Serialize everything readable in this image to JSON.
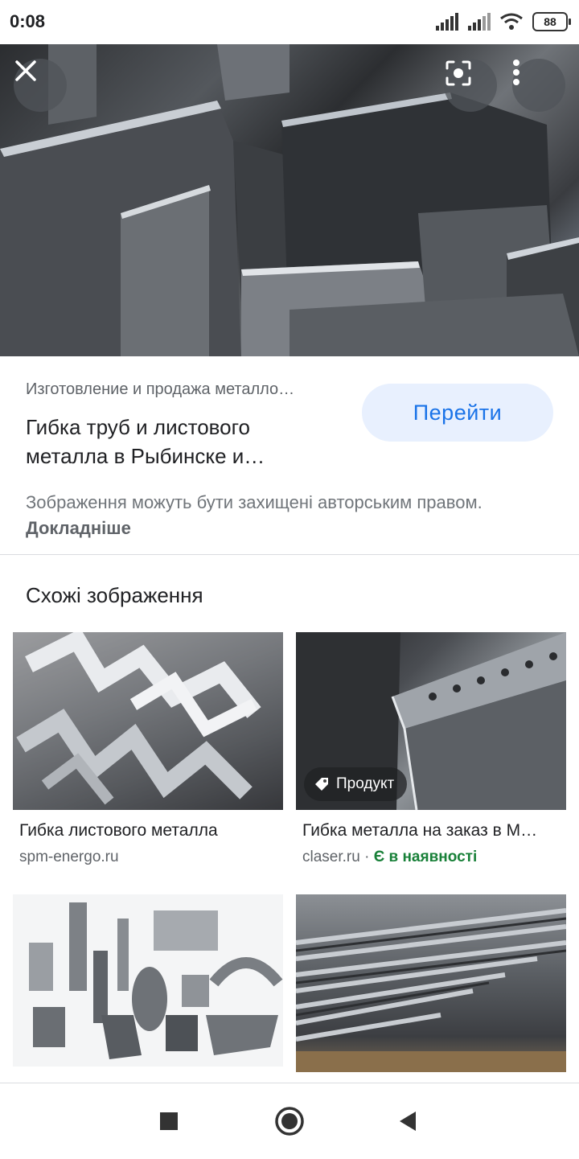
{
  "status_bar": {
    "time": "0:08",
    "battery": "88"
  },
  "hero": {
    "close_icon": "close-icon",
    "lens_icon": "lens-icon",
    "more_icon": "more-vert-icon"
  },
  "result": {
    "source": "Изготовление и продажа металло…",
    "title": "Гибка труб и листового металла в Рыбинске и…",
    "visit_label": "Перейти",
    "copyright_text": "Зображення можуть бути захищені авторським правом.",
    "copyright_link": "Докладніше"
  },
  "related": {
    "heading": "Схожі зображення",
    "cards": [
      {
        "title": "Гибка листового металла",
        "domain": "spm-energo.ru"
      },
      {
        "title": "Гибка металла на заказ в М…",
        "domain": "claser.ru",
        "separator": "·",
        "stock": "Є в наявності",
        "badge": "Продукт"
      },
      {
        "title": "",
        "domain": ""
      },
      {
        "title": "",
        "domain": ""
      }
    ]
  },
  "colors": {
    "accent": "#1a73e8",
    "accent_bg": "#e8f0fe",
    "in_stock": "#188038"
  }
}
